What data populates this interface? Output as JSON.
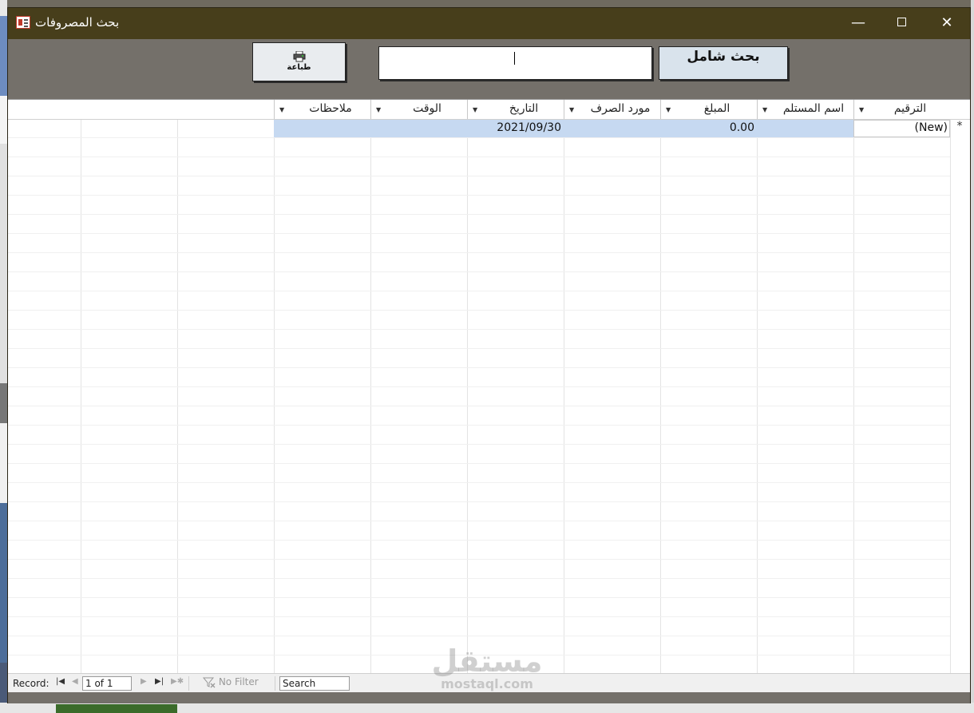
{
  "window": {
    "title": "بحث المصروفات"
  },
  "toolbar": {
    "print_label": "طباعة",
    "search_value": "",
    "search_button_label": "بحث شامل"
  },
  "datasheet": {
    "columns": [
      {
        "label": "الترقيم"
      },
      {
        "label": "اسم المستلم"
      },
      {
        "label": "المبلغ"
      },
      {
        "label": "مورد الصرف"
      },
      {
        "label": "التاريخ"
      },
      {
        "label": "الوقت"
      },
      {
        "label": "ملاحظات"
      }
    ],
    "new_row": {
      "marker": "*",
      "id": "(New)",
      "amount": "0.00",
      "date": "2021/09/30"
    }
  },
  "navigation": {
    "record_label": "Record:",
    "position": "1 of 1",
    "filter_label": "No Filter",
    "search_label": "Search"
  },
  "watermark": {
    "arabic": "مستقل",
    "latin": "mostaql.com"
  },
  "colors": {
    "titlebar": "#473e1b",
    "new_row": "#c6d9f1",
    "form_bg": "#74706a"
  }
}
